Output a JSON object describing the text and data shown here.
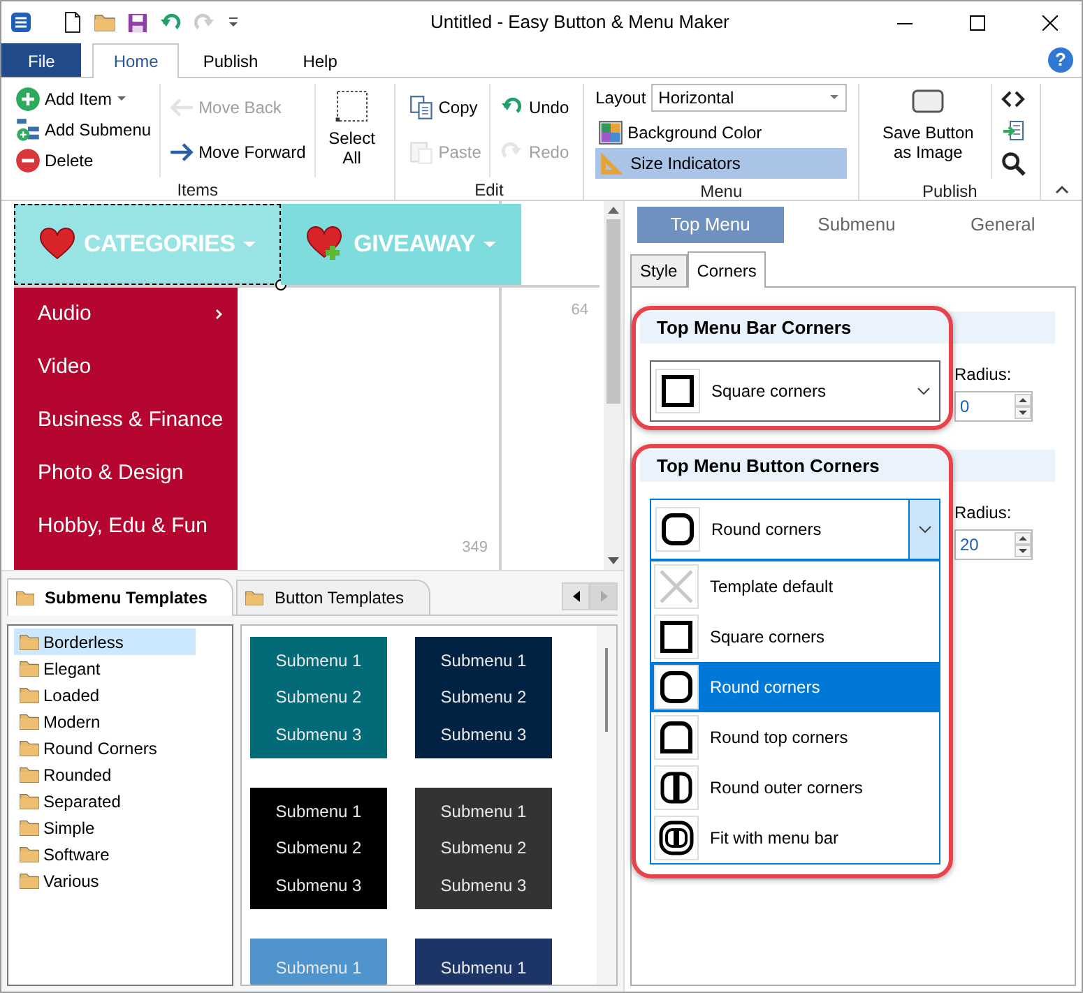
{
  "window": {
    "title": "Untitled - Easy Button & Menu Maker"
  },
  "ribbon": {
    "tabs": [
      {
        "label": "File",
        "kind": "file",
        "selected": false
      },
      {
        "label": "Home",
        "kind": "tab",
        "selected": true
      },
      {
        "label": "Publish",
        "kind": "tab",
        "selected": false
      },
      {
        "label": "Help",
        "kind": "tab",
        "selected": false
      }
    ],
    "help_label": "?",
    "groups": [
      {
        "label": "Items",
        "columns": [
          [
            {
              "kind": "small",
              "label": "Add Item",
              "has_menu": true,
              "disabled": false,
              "active": false
            },
            {
              "kind": "small",
              "label": "Add Submenu",
              "disabled": false,
              "active": false
            },
            {
              "kind": "small",
              "label": "Delete",
              "disabled": false,
              "active": false
            }
          ],
          [
            {
              "kind": "small",
              "label": "Move Back",
              "disabled": true,
              "active": false
            },
            {
              "kind": "small",
              "label": "Move Forward",
              "disabled": false,
              "active": false
            }
          ],
          [
            {
              "kind": "large",
              "label": "Select All",
              "disabled": false,
              "active": false
            }
          ]
        ]
      },
      {
        "label": "Edit",
        "columns": [
          [
            {
              "kind": "small",
              "label": "Copy",
              "disabled": false,
              "active": false
            },
            {
              "kind": "small",
              "label": "Paste",
              "disabled": true,
              "active": false
            }
          ],
          [
            {
              "kind": "small",
              "label": "Undo",
              "disabled": false,
              "active": false
            },
            {
              "kind": "small",
              "label": "Redo",
              "disabled": true,
              "active": false
            }
          ]
        ]
      },
      {
        "label": "Menu",
        "columns": [
          [
            {
              "kind": "select",
              "label": "Layout",
              "value": "Horizontal",
              "disabled": false,
              "active": false
            },
            {
              "kind": "small",
              "label": "Background Color",
              "disabled": false,
              "active": false
            },
            {
              "kind": "small",
              "label": "Size Indicators",
              "disabled": false,
              "active": true
            }
          ]
        ]
      },
      {
        "label": "Publish",
        "columns": [
          [
            {
              "kind": "large",
              "label": "Save Button as Image",
              "disabled": false,
              "active": false
            }
          ],
          [
            {
              "kind": "icon",
              "disabled": false,
              "active": false
            },
            {
              "kind": "icon",
              "disabled": false,
              "active": false
            },
            {
              "kind": "icon",
              "disabled": false,
              "active": false
            }
          ]
        ]
      }
    ]
  },
  "canvas": {
    "top_items": [
      {
        "label": "CATEGORIES",
        "selected": true
      },
      {
        "label": "GIVEAWAY",
        "selected": false
      }
    ],
    "submenu_items": [
      {
        "label": "Audio",
        "has_submenu": true
      },
      {
        "label": "Video",
        "has_submenu": false
      },
      {
        "label": "Business & Finance",
        "has_submenu": false
      },
      {
        "label": "Photo & Design",
        "has_submenu": false
      },
      {
        "label": "Hobby, Edu & Fun",
        "has_submenu": false
      }
    ],
    "width_indicator": "64",
    "height_indicator": "349"
  },
  "templates": {
    "tabs": [
      {
        "label": "Submenu Templates",
        "selected": true
      },
      {
        "label": "Button Templates",
        "selected": false
      }
    ],
    "categories": [
      {
        "label": "Borderless",
        "selected": true
      },
      {
        "label": "Elegant",
        "selected": false
      },
      {
        "label": "Loaded",
        "selected": false
      },
      {
        "label": "Modern",
        "selected": false
      },
      {
        "label": "Round Corners",
        "selected": false
      },
      {
        "label": "Rounded",
        "selected": false
      },
      {
        "label": "Separated",
        "selected": false
      },
      {
        "label": "Simple",
        "selected": false
      },
      {
        "label": "Software",
        "selected": false
      },
      {
        "label": "Various",
        "selected": false
      }
    ],
    "previews": [
      {
        "color": "#036b77",
        "items": [
          "Submenu 1",
          "Submenu 2",
          "Submenu 3"
        ]
      },
      {
        "color": "#012242",
        "items": [
          "Submenu 1",
          "Submenu 2",
          "Submenu 3"
        ]
      },
      {
        "color": "#000000",
        "items": [
          "Submenu 1",
          "Submenu 2",
          "Submenu 3"
        ]
      },
      {
        "color": "#333333",
        "items": [
          "Submenu 1",
          "Submenu 2",
          "Submenu 3"
        ]
      },
      {
        "color": "#4f94cd",
        "items": [
          "Submenu 1"
        ]
      },
      {
        "color": "#1d3466",
        "items": [
          "Submenu 1"
        ]
      }
    ]
  },
  "properties": {
    "tabs": [
      {
        "label": "Top Menu",
        "selected": true
      },
      {
        "label": "Submenu",
        "selected": false
      },
      {
        "label": "General",
        "selected": false
      }
    ],
    "subtabs": [
      {
        "label": "Style",
        "selected": false
      },
      {
        "label": "Corners",
        "selected": true
      }
    ],
    "sections": [
      {
        "title": "Top Menu Bar Corners",
        "highlighted": true,
        "value": "Square corners",
        "open": false,
        "radius_label": "Radius:",
        "radius": "0"
      },
      {
        "title": "Top Menu Button Corners",
        "highlighted": true,
        "value": "Round corners",
        "open": true,
        "radius_label": "Radius:",
        "radius": "20"
      }
    ],
    "dropdown_options": [
      {
        "label": "Template default",
        "selected": false
      },
      {
        "label": "Square corners",
        "selected": false
      },
      {
        "label": "Round corners",
        "selected": true
      },
      {
        "label": "Round top corners",
        "selected": false
      },
      {
        "label": "Round outer corners",
        "selected": false
      },
      {
        "label": "Fit with menu bar",
        "selected": false
      }
    ]
  }
}
